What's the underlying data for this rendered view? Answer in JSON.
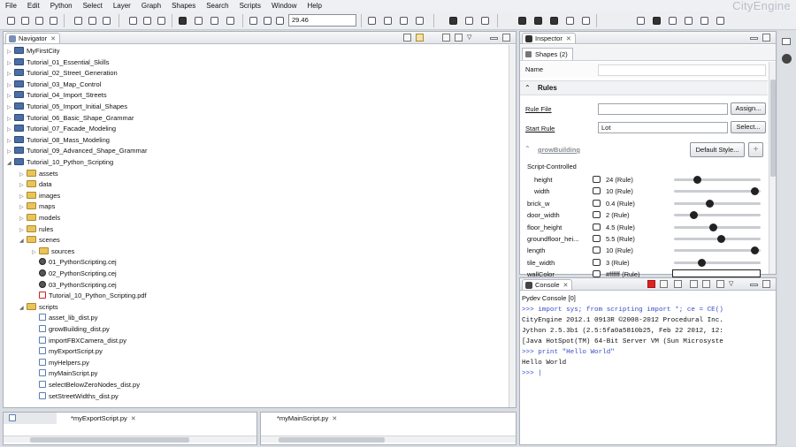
{
  "menu": [
    "File",
    "Edit",
    "Python",
    "Select",
    "Layer",
    "Graph",
    "Shapes",
    "Search",
    "Scripts",
    "Window",
    "Help"
  ],
  "brand": "CityEngine",
  "toolbar": {
    "zoom_value": "29.46"
  },
  "navigator": {
    "title": "Navigator",
    "items": [
      {
        "label": "MyFirstCity",
        "type": "proj",
        "depth": 0,
        "twisty": "▷"
      },
      {
        "label": "Tutorial_01_Essential_Skills",
        "type": "proj",
        "depth": 0,
        "twisty": "▷"
      },
      {
        "label": "Tutorial_02_Street_Generation",
        "type": "proj",
        "depth": 0,
        "twisty": "▷"
      },
      {
        "label": "Tutorial_03_Map_Control",
        "type": "proj",
        "depth": 0,
        "twisty": "▷"
      },
      {
        "label": "Tutorial_04_Import_Streets",
        "type": "proj",
        "depth": 0,
        "twisty": "▷"
      },
      {
        "label": "Tutorial_05_Import_Initial_Shapes",
        "type": "proj",
        "depth": 0,
        "twisty": "▷"
      },
      {
        "label": "Tutorial_06_Basic_Shape_Grammar",
        "type": "proj",
        "depth": 0,
        "twisty": "▷"
      },
      {
        "label": "Tutorial_07_Facade_Modeling",
        "type": "proj",
        "depth": 0,
        "twisty": "▷"
      },
      {
        "label": "Tutorial_08_Mass_Modeling",
        "type": "proj",
        "depth": 0,
        "twisty": "▷"
      },
      {
        "label": "Tutorial_09_Advanced_Shape_Grammar",
        "type": "proj",
        "depth": 0,
        "twisty": "▷"
      },
      {
        "label": "Tutorial_10_Python_Scripting",
        "type": "proj",
        "depth": 0,
        "twisty": "◢"
      },
      {
        "label": "assets",
        "type": "fold",
        "depth": 1,
        "twisty": "▷"
      },
      {
        "label": "data",
        "type": "fold",
        "depth": 1,
        "twisty": "▷"
      },
      {
        "label": "images",
        "type": "fold",
        "depth": 1,
        "twisty": "▷"
      },
      {
        "label": "maps",
        "type": "fold",
        "depth": 1,
        "twisty": "▷"
      },
      {
        "label": "models",
        "type": "fold",
        "depth": 1,
        "twisty": "▷"
      },
      {
        "label": "rules",
        "type": "fold",
        "depth": 1,
        "twisty": "▷"
      },
      {
        "label": "scenes",
        "type": "fold",
        "depth": 1,
        "twisty": "◢"
      },
      {
        "label": "sources",
        "type": "fold",
        "depth": 2,
        "twisty": "▷"
      },
      {
        "label": "01_PythonScripting.cej",
        "type": "cej",
        "depth": 2,
        "twisty": ""
      },
      {
        "label": "02_PythonScripting.cej",
        "type": "cej",
        "depth": 2,
        "twisty": ""
      },
      {
        "label": "03_PythonScripting.cej",
        "type": "cej",
        "depth": 2,
        "twisty": ""
      },
      {
        "label": "Tutorial_10_Python_Scripting.pdf",
        "type": "pdf",
        "depth": 2,
        "twisty": ""
      },
      {
        "label": "scripts",
        "type": "fold",
        "depth": 1,
        "twisty": "◢"
      },
      {
        "label": "asset_lib_dist.py",
        "type": "py",
        "depth": 2,
        "twisty": ""
      },
      {
        "label": "growBuilding_dist.py",
        "type": "py",
        "depth": 2,
        "twisty": ""
      },
      {
        "label": "importFBXCamera_dist.py",
        "type": "py",
        "depth": 2,
        "twisty": ""
      },
      {
        "label": "myExportScript.py",
        "type": "py",
        "depth": 2,
        "twisty": ""
      },
      {
        "label": "myHelpers.py",
        "type": "py",
        "depth": 2,
        "twisty": ""
      },
      {
        "label": "myMainScript.py",
        "type": "py",
        "depth": 2,
        "twisty": ""
      },
      {
        "label": "selectBelowZeroNodes_dist.py",
        "type": "py",
        "depth": 2,
        "twisty": ""
      },
      {
        "label": "setStreetWidths_dist.py",
        "type": "py",
        "depth": 2,
        "twisty": ""
      }
    ]
  },
  "inspector": {
    "title": "Inspector",
    "tab": "Shapes (2)",
    "name_label": "Name",
    "rules_heading": "Rules",
    "rule_file_label": "Rule File",
    "assign_button": "Assign...",
    "start_rule_label": "Start Rule",
    "start_rule_value": "Lot",
    "select_button": "Select...",
    "group_name": "growBuilding",
    "default_style_button": "Default Style...",
    "script_controlled": "Script-Controlled",
    "attributes": [
      {
        "name": "height",
        "value": "24 (Rule)",
        "indent": true,
        "level": 0.25
      },
      {
        "name": "width",
        "value": "10 (Rule)",
        "indent": true,
        "level": 0.98
      },
      {
        "name": "brick_w",
        "value": "0.4 (Rule)",
        "indent": false,
        "level": 0.4
      },
      {
        "name": "door_width",
        "value": "2 (Rule)",
        "indent": false,
        "level": 0.2
      },
      {
        "name": "floor_height",
        "value": "4.5 (Rule)",
        "indent": false,
        "level": 0.45
      },
      {
        "name": "groundfloor_hei...",
        "value": "5.5 (Rule)",
        "indent": false,
        "level": 0.55
      },
      {
        "name": "length",
        "value": "10 (Rule)",
        "indent": false,
        "level": 0.98
      },
      {
        "name": "tile_width",
        "value": "3 (Rule)",
        "indent": false,
        "level": 0.3
      },
      {
        "name": "wallColor",
        "value": "#ffffff (Rule)",
        "indent": false,
        "level": null
      }
    ]
  },
  "console": {
    "title": "Console",
    "subtitle": "Pydev Console [0]",
    "lines": [
      {
        "text": ">>> import sys; from scripting import *; ce = CE()",
        "color": "#3a4fc9"
      },
      {
        "text": "CityEngine 2012.1 0913R ©2008-2012 Procedural Inc.",
        "color": "#111"
      },
      {
        "text": "Jython 2.5.3b1 (2.5:5fa0a5810b25, Feb 22 2012, 12:",
        "color": "#111"
      },
      {
        "text": "[Java HotSpot(TM) 64-Bit Server VM (Sun Microsyste",
        "color": "#111"
      },
      {
        "text": ">>> print \"Hello World\"",
        "color": "#3a4fc9"
      },
      {
        "text": "Hello World",
        "color": "#111"
      },
      {
        "text": ">>> |",
        "color": "#3a4fc9"
      }
    ]
  },
  "editor_tabs": [
    {
      "label": "*myExportScript.py"
    },
    {
      "label": "*myMainScript.py"
    }
  ]
}
